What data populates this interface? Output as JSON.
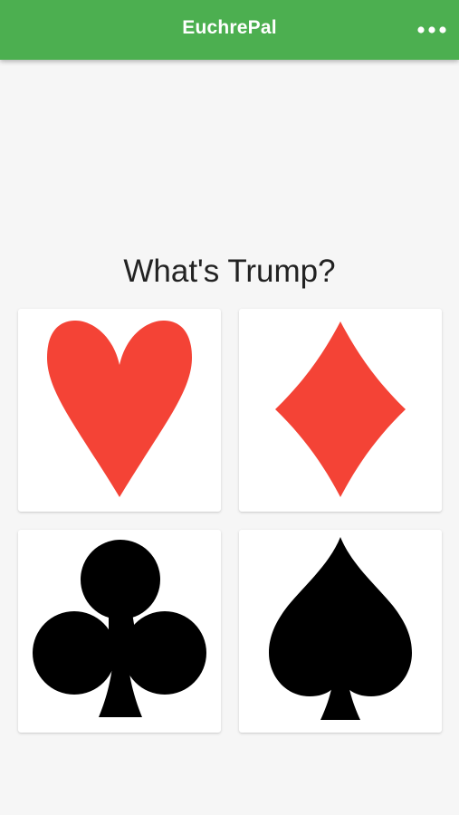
{
  "app": {
    "title": "EuchrePal",
    "menu_icon": "more-horizontal-icon"
  },
  "colors": {
    "app_bar": "#4caf50",
    "red_suit": "#f44336",
    "black_suit": "#000000",
    "background": "#f6f6f6"
  },
  "prompt": "What's Trump?",
  "suits": [
    {
      "name": "hearts",
      "icon": "heart-icon",
      "color": "red"
    },
    {
      "name": "diamonds",
      "icon": "diamond-icon",
      "color": "red"
    },
    {
      "name": "clubs",
      "icon": "club-icon",
      "color": "black"
    },
    {
      "name": "spades",
      "icon": "spade-icon",
      "color": "black"
    }
  ]
}
